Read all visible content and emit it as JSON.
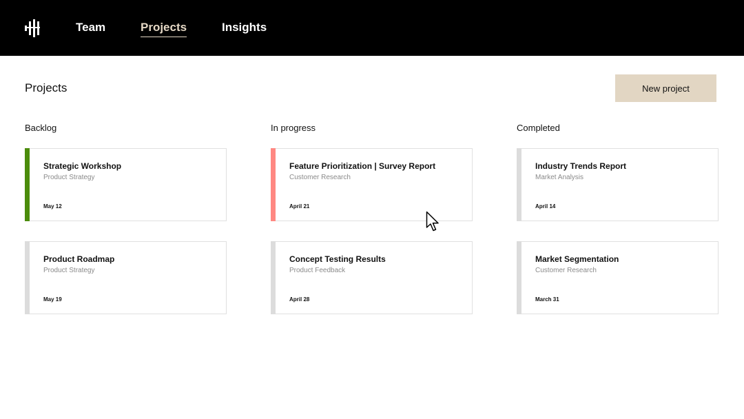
{
  "nav": {
    "logo_icon": "bars-logo-icon",
    "items": [
      {
        "label": "Team",
        "active": false
      },
      {
        "label": "Projects",
        "active": true
      },
      {
        "label": "Insights",
        "active": false
      }
    ]
  },
  "header": {
    "title": "Projects",
    "new_project_label": "New project"
  },
  "colors": {
    "topbar": "#000000",
    "active_nav": "#e4d7c4",
    "button_bg": "#e2d6c3",
    "accent_green": "#4b8c0b",
    "accent_red": "#ff8882",
    "accent_neutral": "#dcdcdc"
  },
  "columns": [
    {
      "title": "Backlog",
      "cards": [
        {
          "title": "Strategic Workshop",
          "subtitle": "Product Strategy",
          "date": "May 12",
          "accent": "#4b8c0b"
        },
        {
          "title": "Product Roadmap",
          "subtitle": "Product Strategy",
          "date": "May 19",
          "accent": "#dcdcdc"
        }
      ]
    },
    {
      "title": "In progress",
      "cards": [
        {
          "title": "Feature Prioritization | Survey Report",
          "subtitle": "Customer Research",
          "date": "April 21",
          "accent": "#ff8882"
        },
        {
          "title": "Concept Testing Results",
          "subtitle": "Product Feedback",
          "date": "April 28",
          "accent": "#dcdcdc"
        }
      ]
    },
    {
      "title": "Completed",
      "cards": [
        {
          "title": "Industry Trends Report",
          "subtitle": "Market Analysis",
          "date": "April 14",
          "accent": "#dcdcdc"
        },
        {
          "title": "Market Segmentation",
          "subtitle": "Customer Research",
          "date": "March 31",
          "accent": "#dcdcdc"
        }
      ]
    }
  ],
  "cursor_icon": "mouse-pointer-icon"
}
